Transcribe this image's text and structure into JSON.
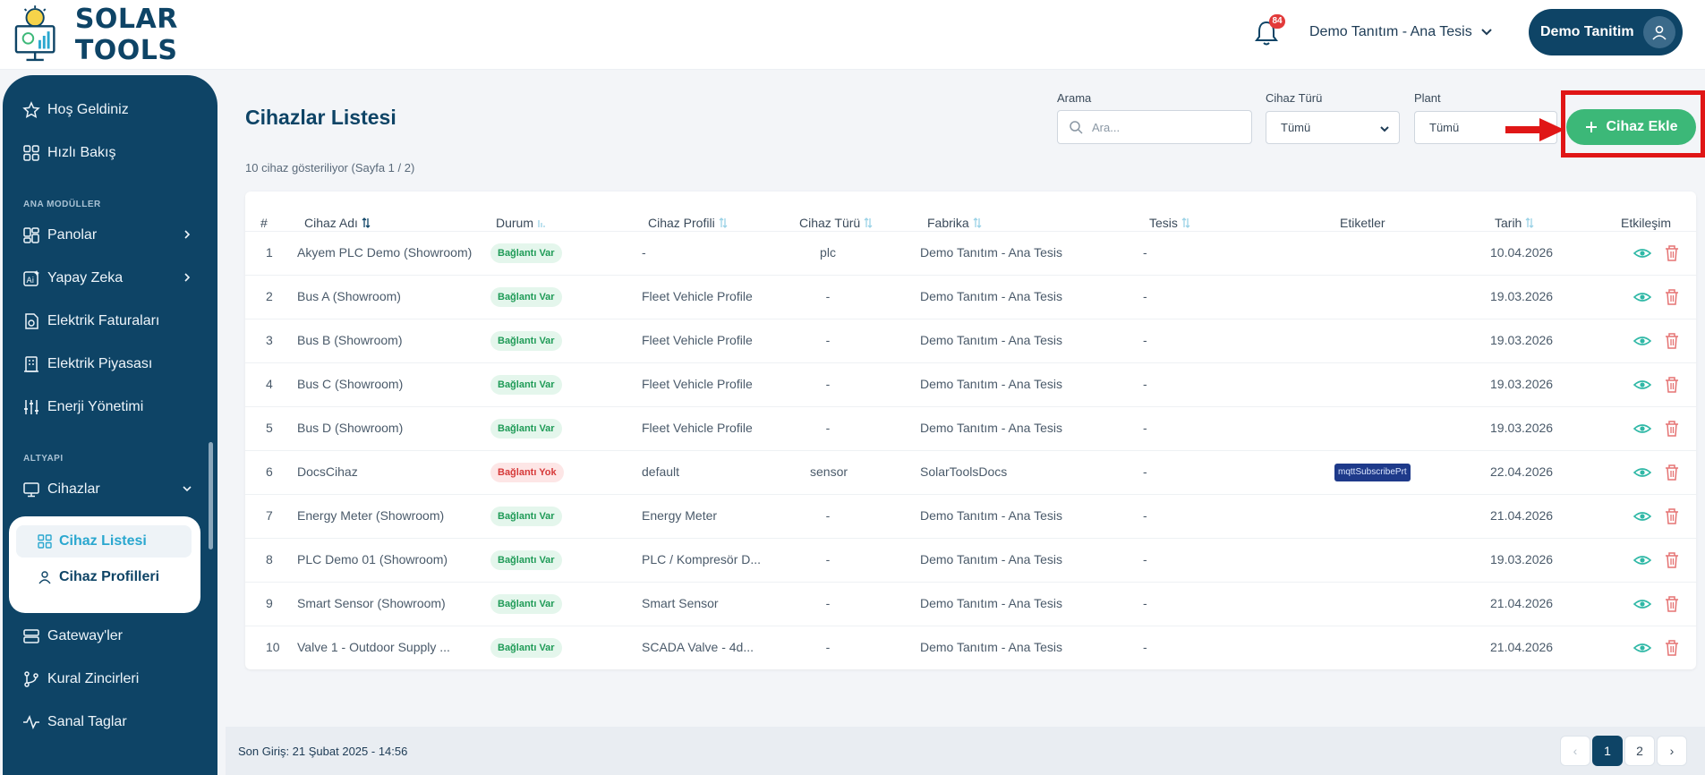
{
  "brand": {
    "name": "SOLAR TOOLS"
  },
  "header": {
    "notification_count": "84",
    "plant_selector": "Demo Tanıtım - Ana Tesis",
    "user_name": "Demo Tanitim"
  },
  "sidebar": {
    "items": [
      {
        "label": "Hoş Geldiniz"
      },
      {
        "label": "Hızlı Bakış"
      },
      {
        "label": "Panolar"
      },
      {
        "label": "Yapay Zeka"
      },
      {
        "label": "Elektrik Faturaları"
      },
      {
        "label": "Elektrik Piyasası"
      },
      {
        "label": "Enerji Yönetimi"
      },
      {
        "label": "Cihazlar"
      },
      {
        "label": "Gateway'ler"
      },
      {
        "label": "Kural Zincirleri"
      },
      {
        "label": "Sanal Taglar"
      }
    ],
    "section_main": "ANA MODÜLLER",
    "section_infra": "ALTYAPI",
    "sub_items": [
      {
        "label": "Cihaz Listesi"
      },
      {
        "label": "Cihaz Profilleri"
      }
    ]
  },
  "page": {
    "title": "Cihazlar Listesi",
    "subtitle": "10 cihaz gösteriliyor (Sayfa 1 / 2)"
  },
  "filters": {
    "search_label": "Arama",
    "search_placeholder": "Ara...",
    "type_label": "Cihaz Türü",
    "type_value": "Tümü",
    "plant_label": "Plant",
    "plant_value": "Tümü",
    "add_button": "Cihaz Ekle"
  },
  "table": {
    "headers": [
      "#",
      "Cihaz Adı",
      "Durum",
      "Cihaz Profili",
      "Cihaz Türü",
      "Fabrika",
      "Tesis",
      "Etiketler",
      "Tarih",
      "Etkileşim"
    ],
    "rows": [
      {
        "n": "1",
        "name": "Akyem PLC Demo (Showroom)",
        "status": "Bağlantı Var",
        "ok": true,
        "profile": "-",
        "type": "plc",
        "factory": "Demo Tanıtım - Ana Tesis",
        "site": "-",
        "tag": "",
        "date": "10.04.2026"
      },
      {
        "n": "2",
        "name": "Bus A (Showroom)",
        "status": "Bağlantı Var",
        "ok": true,
        "profile": "Fleet Vehicle Profile",
        "type": "-",
        "factory": "Demo Tanıtım - Ana Tesis",
        "site": "-",
        "tag": "",
        "date": "19.03.2026"
      },
      {
        "n": "3",
        "name": "Bus B (Showroom)",
        "status": "Bağlantı Var",
        "ok": true,
        "profile": "Fleet Vehicle Profile",
        "type": "-",
        "factory": "Demo Tanıtım - Ana Tesis",
        "site": "-",
        "tag": "",
        "date": "19.03.2026"
      },
      {
        "n": "4",
        "name": "Bus C (Showroom)",
        "status": "Bağlantı Var",
        "ok": true,
        "profile": "Fleet Vehicle Profile",
        "type": "-",
        "factory": "Demo Tanıtım - Ana Tesis",
        "site": "-",
        "tag": "",
        "date": "19.03.2026"
      },
      {
        "n": "5",
        "name": "Bus D (Showroom)",
        "status": "Bağlantı Var",
        "ok": true,
        "profile": "Fleet Vehicle Profile",
        "type": "-",
        "factory": "Demo Tanıtım - Ana Tesis",
        "site": "-",
        "tag": "",
        "date": "19.03.2026"
      },
      {
        "n": "6",
        "name": "DocsCihaz",
        "status": "Bağlantı Yok",
        "ok": false,
        "profile": "default",
        "type": "sensor",
        "factory": "SolarToolsDocs",
        "site": "-",
        "tag": "mqttSubscribePrt",
        "date": "22.04.2026"
      },
      {
        "n": "7",
        "name": "Energy Meter (Showroom)",
        "status": "Bağlantı Var",
        "ok": true,
        "profile": "Energy Meter",
        "type": "-",
        "factory": "Demo Tanıtım - Ana Tesis",
        "site": "-",
        "tag": "",
        "date": "21.04.2026"
      },
      {
        "n": "8",
        "name": "PLC Demo 01 (Showroom)",
        "status": "Bağlantı Var",
        "ok": true,
        "profile": "PLC / Kompresör D...",
        "type": "-",
        "factory": "Demo Tanıtım - Ana Tesis",
        "site": "-",
        "tag": "",
        "date": "19.03.2026"
      },
      {
        "n": "9",
        "name": "Smart Sensor (Showroom)",
        "status": "Bağlantı Var",
        "ok": true,
        "profile": "Smart Sensor",
        "type": "-",
        "factory": "Demo Tanıtım - Ana Tesis",
        "site": "-",
        "tag": "",
        "date": "21.04.2026"
      },
      {
        "n": "10",
        "name": "Valve 1 - Outdoor Supply ...",
        "status": "Bağlantı Var",
        "ok": true,
        "profile": "SCADA Valve - 4d...",
        "type": "-",
        "factory": "Demo Tanıtım - Ana Tesis",
        "site": "-",
        "tag": "",
        "date": "21.04.2026"
      }
    ]
  },
  "footer": {
    "last_login": "Son Giriş: 21 Şubat 2025 - 14:56",
    "prev": "‹",
    "pages": [
      "1",
      "2"
    ],
    "next": "›"
  },
  "colors": {
    "primary": "#0e4466",
    "accent": "#2aa7cf",
    "success": "#3cb878",
    "danger": "#e01616"
  }
}
